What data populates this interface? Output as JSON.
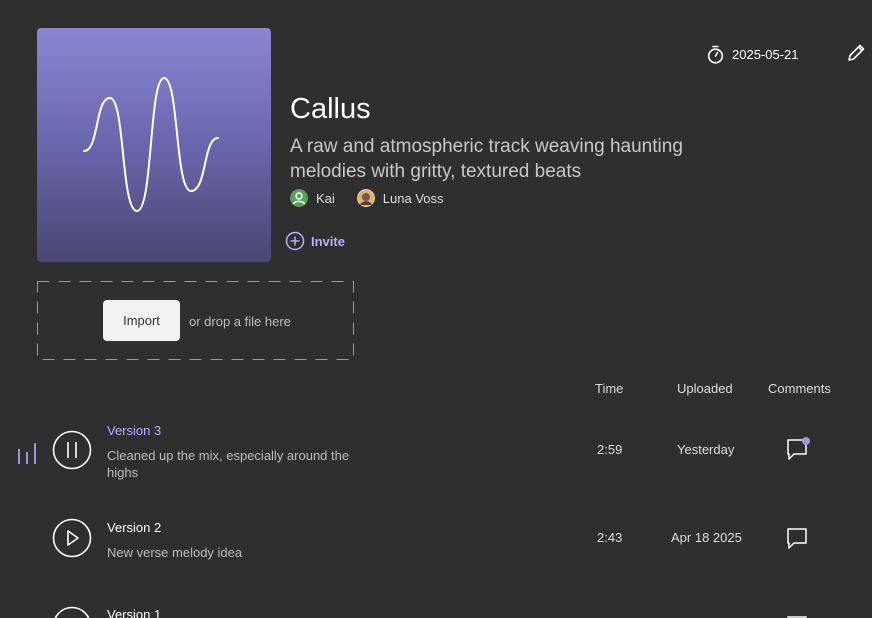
{
  "header": {
    "date": "2025-05-21",
    "title": "Callus",
    "description": "A raw and atmospheric track weaving haunting melodies with gritty, textured beats"
  },
  "collaborators": [
    {
      "name": "Kai",
      "avatar_color": "#5aa05a"
    },
    {
      "name": "Luna Voss",
      "avatar_color": "#e0b070"
    }
  ],
  "invite_label": "Invite",
  "import": {
    "button_label": "Import",
    "hint": "or drop a file here"
  },
  "columns": {
    "time": "Time",
    "uploaded": "Uploaded",
    "comments": "Comments"
  },
  "versions": [
    {
      "title": "Version 3",
      "note": "Cleaned up the mix, especially around the highs",
      "time": "2:59",
      "uploaded": "Yesterday",
      "state": "playing",
      "has_new_comment": true
    },
    {
      "title": "Version 2",
      "note": "New verse melody idea",
      "time": "2:43",
      "uploaded": "Apr 18 2025",
      "state": "paused",
      "has_new_comment": false
    },
    {
      "title": "Version 1",
      "note": "",
      "time": "",
      "uploaded": "",
      "state": "paused",
      "has_new_comment": false
    }
  ],
  "colors": {
    "background": "#2f2f2f",
    "accent": "#b6b0ff",
    "cover_top": "#8a86d4",
    "cover_bottom": "#4a4773"
  },
  "icons": {
    "timer": "stopwatch-icon",
    "edit": "pencil-icon",
    "invite": "plus-circle-icon",
    "play": "play-icon",
    "pause": "pause-icon",
    "comment": "comment-icon",
    "now_playing": "equalizer-icon"
  }
}
